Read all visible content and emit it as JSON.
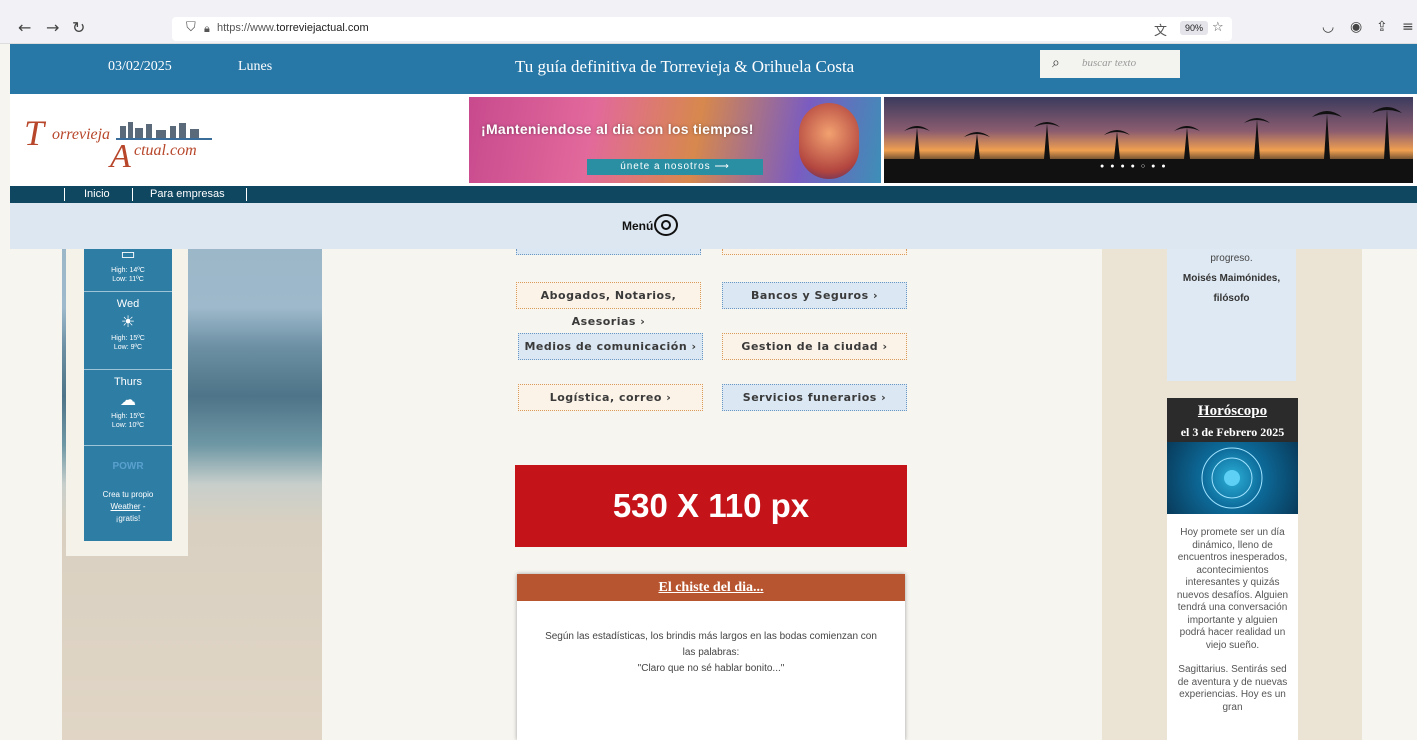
{
  "browser": {
    "url_prefix": "https://www.",
    "url_domain": "torreviejactual.com",
    "zoom": "90%"
  },
  "topbar": {
    "date": "03/02/2025",
    "day": "Lunes",
    "tagline": "Tu guía definitiva de Torrevieja & Orihuela Costa",
    "search_placeholder": "buscar texto"
  },
  "logo": {
    "part1": "T",
    "part2": "orrevieja",
    "part3": "A",
    "part4": "ctual.com"
  },
  "banner": {
    "text": "¡Manteniendose al dia con los tiempos!",
    "button": "únete a nosotros ⟶"
  },
  "nav": {
    "items": [
      "Inicio",
      "Para empresas"
    ]
  },
  "menu": {
    "label": "Menú"
  },
  "weather": {
    "days": [
      {
        "day": "",
        "high": "High: 14ºC",
        "low": "Low: 11ºC"
      },
      {
        "day": "Wed",
        "high": "High: 15ºC",
        "low": "Low: 9ºC"
      },
      {
        "day": "Thurs",
        "high": "High: 15ºC",
        "low": "Low: 10ºC"
      }
    ],
    "powr": "POWR",
    "powr_line1": "Crea tu propio",
    "powr_link": "Weather",
    "powr_line2": "¡gratis!"
  },
  "categories": [
    "Abogados, Notarios, Asesorias ›",
    "Bancos y Seguros ›",
    "Medios de comunicación ›",
    "Gestion de la ciudad ›",
    "Logística, correo ›",
    "Servicios funerarios ›"
  ],
  "ad": {
    "text": "530 X 110 px"
  },
  "joke": {
    "title": "El chiste del dia...",
    "line1": "Según las estadísticas, los brindis más largos en las bodas comienzan con",
    "line2": "las palabras:",
    "line3": "\"Claro que no sé hablar bonito...\""
  },
  "quote": {
    "tail": "progreso.",
    "author1": "Moisés Maimónides,",
    "author2": "filósofo"
  },
  "horoscope": {
    "title": "Horóscopo",
    "date": "el 3 de Febrero 2025",
    "text1": "Hoy promete ser un día dinámico, lleno de encuentros inesperados, acontecimientos interesantes y quizás nuevos desafíos. Alguien tendrá una conversación importante y alguien podrá hacer realidad un viejo sueño.",
    "text2": "Sagittarius. Sentirás sed de aventura y de nuevas experiencias. Hoy es un gran"
  }
}
